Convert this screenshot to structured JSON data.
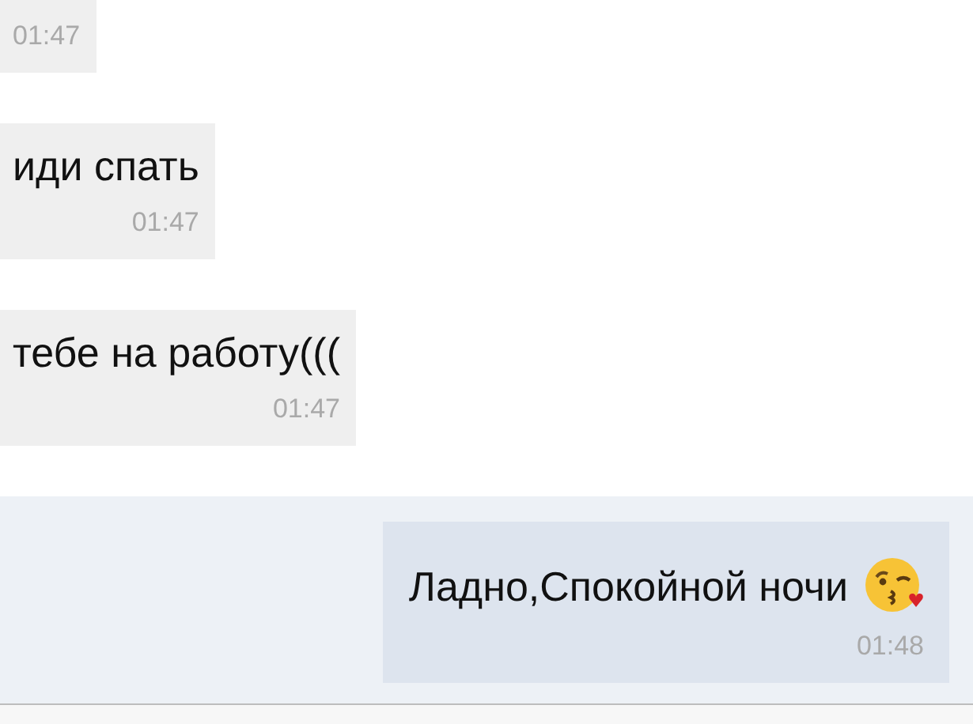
{
  "messages": [
    {
      "time": "01:47",
      "outgoing": false
    },
    {
      "text": "иди спать",
      "time": "01:47",
      "outgoing": false
    },
    {
      "text": "тебе на работу(((",
      "time": "01:47",
      "outgoing": false
    },
    {
      "text": "Ладно,Спокойной ночи",
      "time": "01:48",
      "outgoing": true,
      "emoji": true
    }
  ]
}
